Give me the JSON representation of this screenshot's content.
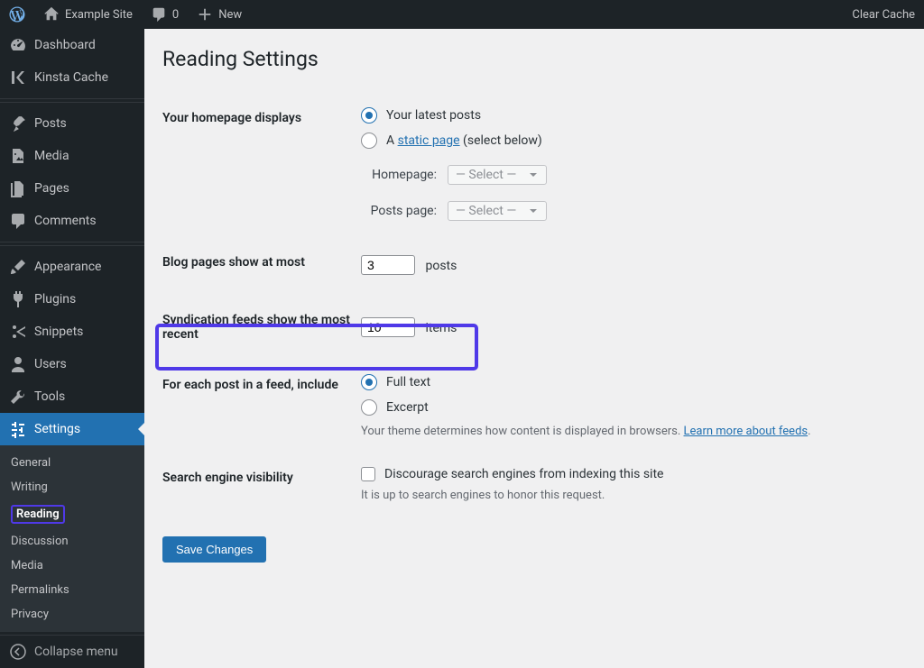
{
  "adminbar": {
    "site_name": "Example Site",
    "comments_count": "0",
    "new_label": "New",
    "clear_cache": "Clear Cache"
  },
  "sidebar": {
    "dashboard": "Dashboard",
    "kinsta": "Kinsta Cache",
    "posts": "Posts",
    "media": "Media",
    "pages": "Pages",
    "comments": "Comments",
    "appearance": "Appearance",
    "plugins": "Plugins",
    "snippets": "Snippets",
    "users": "Users",
    "tools": "Tools",
    "settings": "Settings",
    "collapse": "Collapse menu",
    "settings_sub": {
      "general": "General",
      "writing": "Writing",
      "reading": "Reading",
      "discussion": "Discussion",
      "media": "Media",
      "permalinks": "Permalinks",
      "privacy": "Privacy"
    }
  },
  "page": {
    "title": "Reading Settings",
    "homepage_displays_label": "Your homepage displays",
    "latest_posts": "Your latest posts",
    "a_prefix": "A ",
    "static_page_link": "static page",
    "select_below": " (select below)",
    "homepage_label": "Homepage:",
    "posts_page_label": "Posts page:",
    "select_placeholder": "— Select —",
    "blog_pages_label": "Blog pages show at most",
    "blog_pages_value": "3",
    "posts_suffix": "posts",
    "syndication_label": "Syndication feeds show the most recent",
    "syndication_value": "10",
    "items_suffix": "items",
    "feed_include_label": "For each post in a feed, include",
    "full_text": "Full text",
    "excerpt": "Excerpt",
    "feed_desc_prefix": "Your theme determines how content is displayed in browsers. ",
    "feed_desc_link": "Learn more about feeds",
    "feed_desc_suffix": ".",
    "sev_label": "Search engine visibility",
    "sev_checkbox": "Discourage search engines from indexing this site",
    "sev_desc": "It is up to search engines to honor this request.",
    "save": "Save Changes"
  }
}
